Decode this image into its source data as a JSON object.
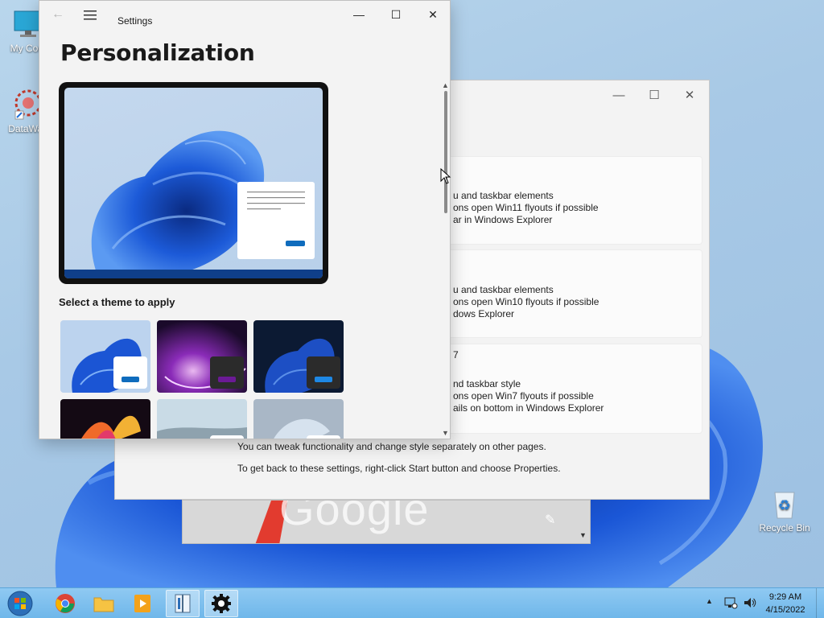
{
  "desktop": {
    "icons": [
      {
        "label": "My Com",
        "icon": "monitor-icon"
      },
      {
        "label": "DataWag",
        "icon": "datawag-icon"
      },
      {
        "label": "Recycle Bin",
        "icon": "recycle-bin-icon"
      }
    ]
  },
  "back_window": {
    "options": [
      {
        "lines": [
          "u and taskbar elements",
          "ons open Win11 flyouts if possible",
          "ar in Windows Explorer"
        ]
      },
      {
        "lines": [
          "u and taskbar elements",
          "ons open Win10 flyouts if possible",
          "dows Explorer"
        ]
      },
      {
        "heading": "7",
        "lines": [
          "nd taskbar style",
          "ons open Win7 flyouts if possible",
          "ails on bottom in Windows Explorer"
        ]
      }
    ],
    "notes": [
      "You can tweak functionality and change style separately on other pages.",
      "To get back to these settings, right-click Start button and choose Properties."
    ]
  },
  "browser": {
    "logo_text": "Google"
  },
  "settings": {
    "title": "Settings",
    "page_title": "Personalization",
    "section_label": "Select a theme to apply",
    "themes": [
      {
        "name": "windows-light",
        "accent": "#0f6cbd"
      },
      {
        "name": "glow",
        "accent": "#6b1a96"
      },
      {
        "name": "windows-dark",
        "accent": "#1565c0"
      },
      {
        "name": "captured-motion",
        "accent": "#e05a2a"
      },
      {
        "name": "sunrise",
        "accent": "#8aa1b5"
      },
      {
        "name": "flow",
        "accent": "#7f95b0"
      }
    ]
  },
  "taskbar": {
    "apps": [
      {
        "name": "start",
        "icon": "windows-orb-icon"
      },
      {
        "name": "chrome",
        "icon": "chrome-icon"
      },
      {
        "name": "explorer",
        "icon": "folder-icon"
      },
      {
        "name": "media",
        "icon": "media-player-icon"
      },
      {
        "name": "startallback",
        "icon": "startallback-icon"
      },
      {
        "name": "settings",
        "icon": "gear-icon"
      }
    ],
    "clock": {
      "time": "9:29 AM",
      "date": "4/15/2022"
    }
  },
  "colors": {
    "accent": "#0f6cbd",
    "taskbar": "#7fc0ee",
    "bloom": "#1a5fd6"
  }
}
